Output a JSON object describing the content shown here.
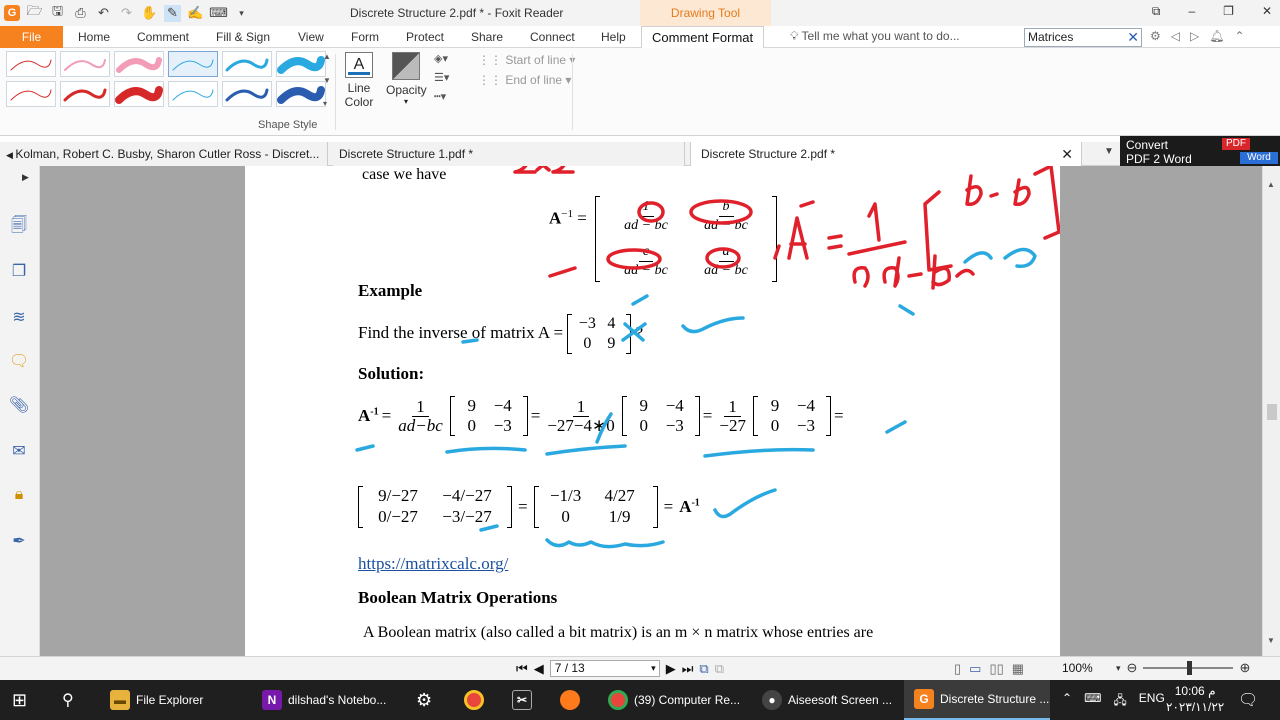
{
  "window": {
    "title": "Discrete Structure 2.pdf * - Foxit Reader",
    "context_tab": "Drawing Tool",
    "controls": [
      "⧉",
      "–",
      "❐",
      "✕"
    ]
  },
  "menu": {
    "file": "File",
    "tabs": [
      "Home",
      "Comment",
      "Fill & Sign",
      "View",
      "Form",
      "Protect",
      "Share",
      "Connect",
      "Help"
    ],
    "active_tab": "Comment Format",
    "tell_me": "Tell me what you want to do...",
    "search_value": "Matrices"
  },
  "ribbon": {
    "shape_style_label": "Shape Style",
    "line_color_label": "Line",
    "line_color_label2": "Color",
    "opacity_label": "Opacity",
    "start_of_line": "Start of line",
    "end_of_line": "End of line",
    "swatch_colors": [
      "#d62828",
      "#f29cb8",
      "#f29cb8",
      "#2aa9e0",
      "#2aa9e0",
      "#2aa9e0",
      "#d62828",
      "#d62828",
      "#d62828",
      "#2aa9e0",
      "#2a5db0",
      "#2a5db0"
    ],
    "line_color_accent": "#1a6fb8"
  },
  "doc_tabs": [
    {
      "label": "Kolman, Robert C. Busby, Sharon Cutler Ross - Discret..."
    },
    {
      "label": "Discrete Structure 1.pdf *"
    },
    {
      "label": "Discrete Structure 2.pdf *"
    }
  ],
  "convert": {
    "line1": "Convert",
    "line2": "PDF 2 Word",
    "pdf": "PDF",
    "word": "Word"
  },
  "page": {
    "case_text": "case we have",
    "ainv_label": "A",
    "ainv_sup": "−1",
    "m11_num": "1",
    "m11_den": "ad − bc",
    "m12_num": "b",
    "m12_den": "ad − bc",
    "m21_num": "c",
    "m21_den": "ad − bc",
    "m22_num": "a",
    "m22_den": "ad − bc",
    "example": "Example",
    "find_text": "Find the inverse of matrix A =",
    "qmark": "?",
    "A_matrix": [
      "−3",
      "4",
      "0",
      "9"
    ],
    "solution": "Solution:",
    "sol_A": "A",
    "sol_sup": "-1",
    "f1_num": "1",
    "f1_den": "ad−bc",
    "f2_num": "1",
    "f2_den": "−27−4∗0",
    "f3_num": "1",
    "f3_den": "−27",
    "M_matrix": [
      "9",
      "−4",
      "0",
      "−3"
    ],
    "R1_matrix": [
      "9/−27",
      "−4/−27",
      "0/−27",
      "−3/−27"
    ],
    "R2_matrix": [
      "−1/3",
      "4/27",
      "0",
      "1/9"
    ],
    "eq": "=",
    "ainv_end": "A",
    "ainv_end_sup": "-1",
    "link": "https://matrixcalc.org/",
    "boolean_heading": "Boolean Matrix Operations",
    "boolean_text": "A Boolean matrix (also called a bit matrix) is an m × n matrix whose entries are"
  },
  "handwriting": {
    "red": "#e0202a",
    "blue": "#2aa9e0"
  },
  "status": {
    "page_indicator": "7 / 13",
    "zoom": "100%"
  },
  "taskbar": {
    "file_explorer": "File Explorer",
    "onenote": "dilshad's Notebo...",
    "chrome_tab": "(39) Computer Re...",
    "aiseesoft": "Aiseesoft Screen ...",
    "foxit": "Discrete Structure ...",
    "lang": "ENG",
    "time": "10:06 م",
    "date": "٢٠٢٣/١١/٢٢"
  }
}
